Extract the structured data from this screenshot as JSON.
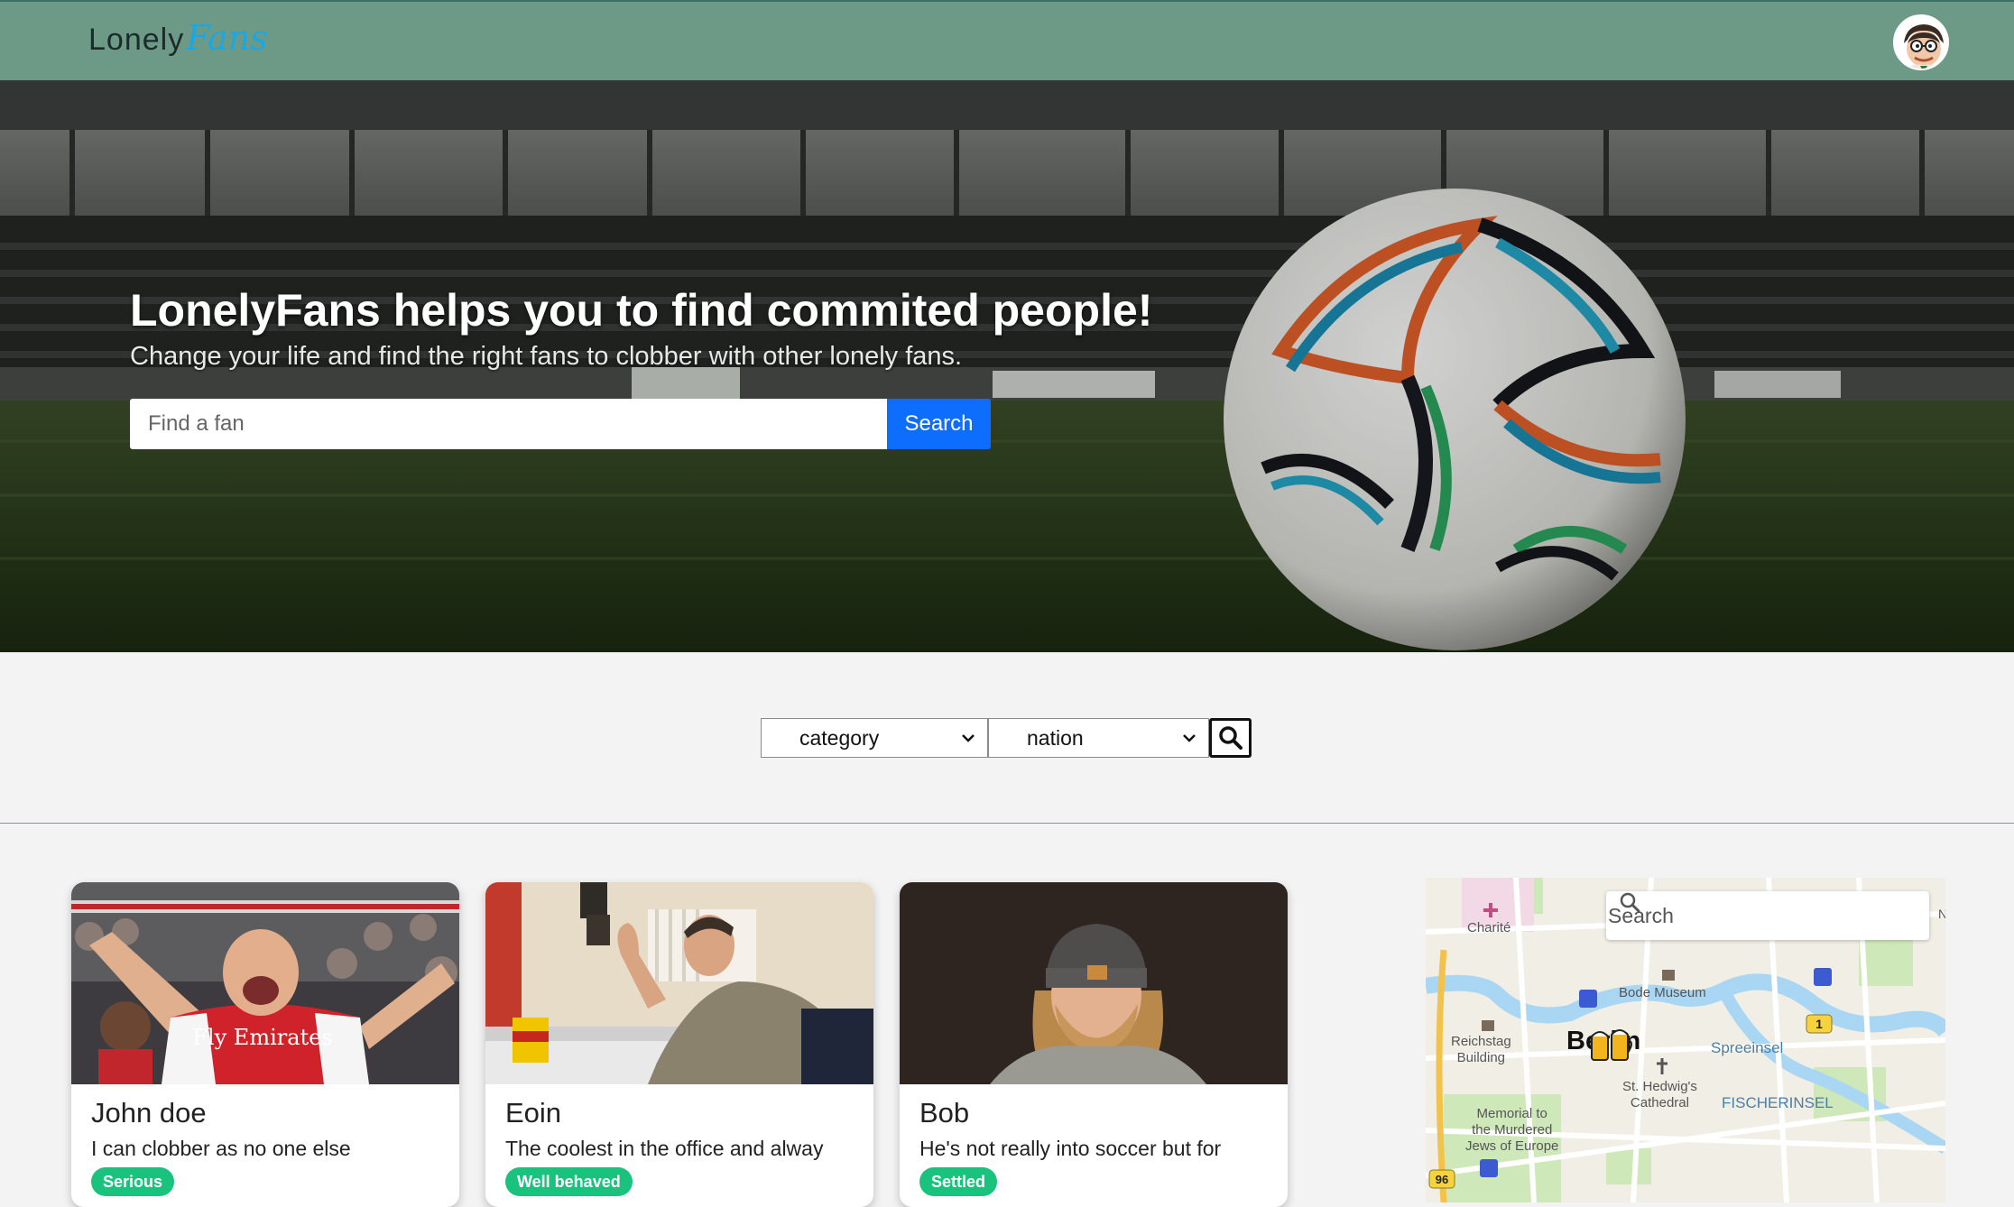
{
  "brand": {
    "logo_text_a": "Lonely",
    "logo_text_b": "Fans"
  },
  "hero": {
    "title": "LonelyFans helps you to find commited people!",
    "subtitle": "Change your life and find the right fans to clobber with other lonely fans.",
    "search_placeholder": "Find a fan",
    "search_button": "Search"
  },
  "filters": {
    "category": "category",
    "nation": "nation"
  },
  "cards": [
    {
      "name": "John doe",
      "description": "I can clobber as no one else",
      "badge": "Serious",
      "shirt_text": "Fly Emirates"
    },
    {
      "name": "Eoin",
      "description": "The coolest in the office and alway",
      "badge": "Well behaved"
    },
    {
      "name": "Bob",
      "description": "He's not really into soccer but for",
      "badge": "Settled"
    }
  ],
  "map": {
    "search_placeholder": "Search",
    "labels": {
      "charite": "Charité",
      "bode": "Bode Museum",
      "reichstag": "Reichstag\nBuilding",
      "berlin": "Berlin",
      "spreeinsel": "Spreeinsel",
      "hedwig": "St. Hedwig's\nCathedral",
      "memorial": "Memorial to\nthe Murdered\nJews of Europe",
      "fischerinsel": "FISCHERINSEL",
      "road96": "96",
      "road1": "1",
      "compass_n": "N"
    }
  },
  "colors": {
    "navbar": "#6d9a87",
    "search_button": "#0d6efd",
    "badge": "#19c37d"
  }
}
